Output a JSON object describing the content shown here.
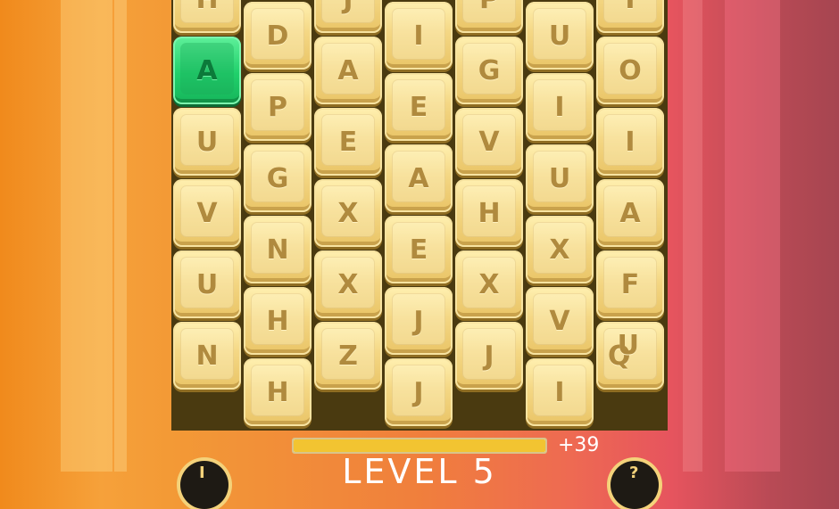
{
  "board": {
    "columns": [
      {
        "tiles": [
          {
            "letter": "H"
          },
          {
            "letter": "A",
            "selected": true
          },
          {
            "letter": "U"
          },
          {
            "letter": "V"
          },
          {
            "letter": "U"
          },
          {
            "letter": "N"
          }
        ]
      },
      {
        "tiles": [
          {
            "letter": "D"
          },
          {
            "letter": "P"
          },
          {
            "letter": "G"
          },
          {
            "letter": "N"
          },
          {
            "letter": "H"
          },
          {
            "letter": "H"
          }
        ]
      },
      {
        "tiles": [
          {
            "letter": "J"
          },
          {
            "letter": "A"
          },
          {
            "letter": "E"
          },
          {
            "letter": "X"
          },
          {
            "letter": "X"
          },
          {
            "letter": "Z"
          }
        ]
      },
      {
        "tiles": [
          {
            "letter": "I"
          },
          {
            "letter": "E"
          },
          {
            "letter": "A"
          },
          {
            "letter": "E"
          },
          {
            "letter": "J"
          },
          {
            "letter": "J"
          }
        ]
      },
      {
        "tiles": [
          {
            "letter": "P"
          },
          {
            "letter": "G"
          },
          {
            "letter": "V"
          },
          {
            "letter": "H"
          },
          {
            "letter": "X"
          },
          {
            "letter": "J"
          }
        ]
      },
      {
        "tiles": [
          {
            "letter": "U"
          },
          {
            "letter": "I"
          },
          {
            "letter": "U"
          },
          {
            "letter": "X"
          },
          {
            "letter": "V"
          },
          {
            "letter": "I"
          }
        ]
      },
      {
        "tiles": [
          {
            "letter": "I"
          },
          {
            "letter": "O"
          },
          {
            "letter": "I"
          },
          {
            "letter": "A"
          },
          {
            "letter": "F"
          },
          {
            "letter": "Q",
            "sub": "U"
          }
        ]
      }
    ]
  },
  "progress": {
    "fraction": 1.0,
    "score_label": "+39"
  },
  "level_label": "LEVEL 5",
  "colors": {
    "tile_face": "#f4d784",
    "tile_letter": "#b08a3e",
    "selected_tile": "#20d06b",
    "board_background": "#4a3a10",
    "progress_fill": "#f2c431"
  },
  "icons": {
    "left_button": "coin-icon",
    "right_button": "hint-icon"
  }
}
